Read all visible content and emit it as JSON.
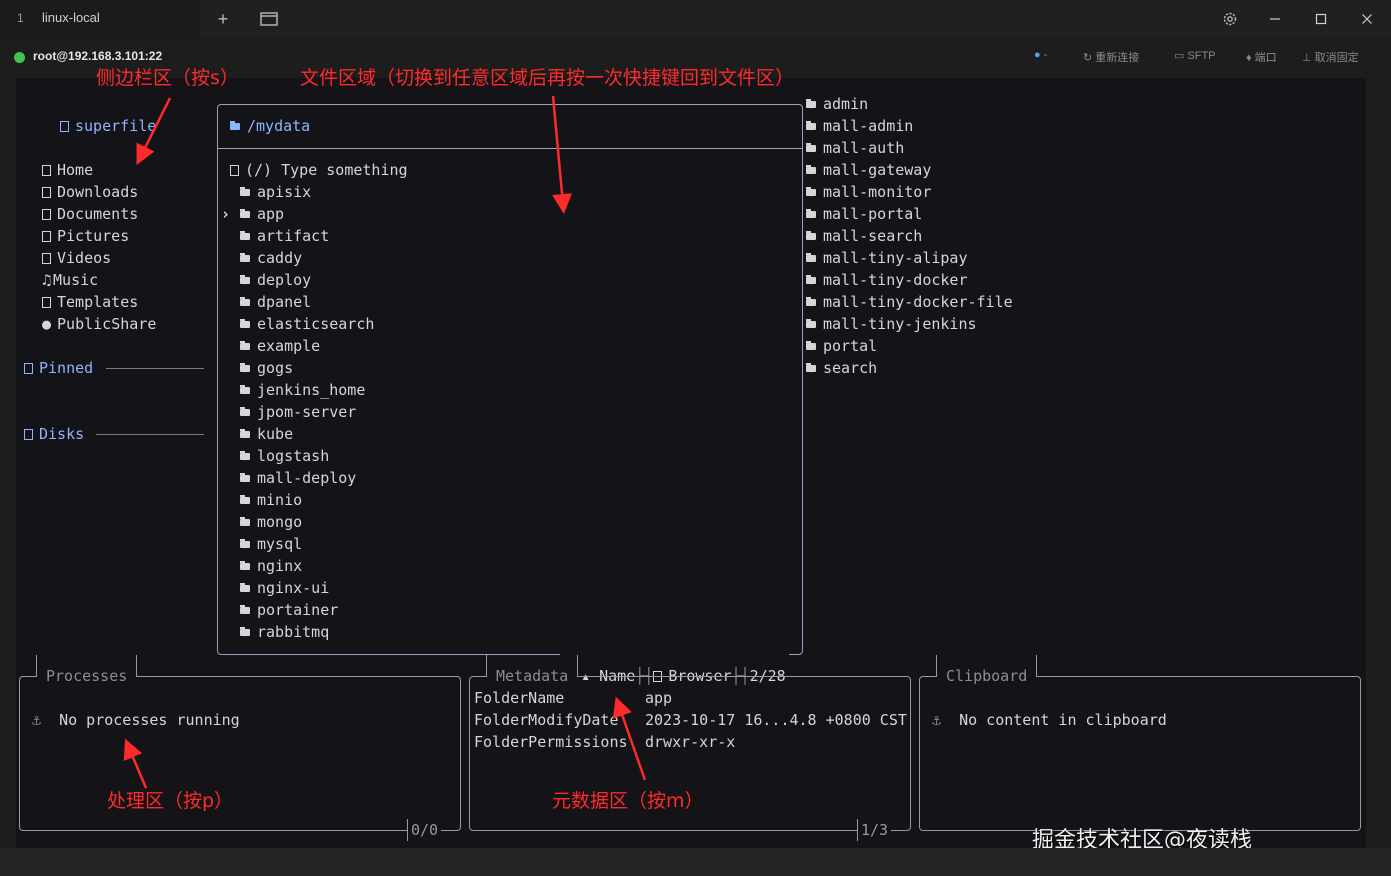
{
  "window": {
    "tab_number": "1",
    "tab_title": "linux-local",
    "new_tab_icon": "plus-icon",
    "tab_overview_icon": "windows-icon",
    "settings_icon": "gear-icon",
    "minimize_icon": "minimize-icon",
    "maximize_icon": "maximize-icon",
    "close_icon": "close-icon"
  },
  "status": {
    "host": "root@192.168.3.101:22",
    "connected_color": "#3fc44f",
    "hint": "-",
    "reconnect": "重新连接",
    "sftp": "SFTP",
    "port": "端口",
    "unpin": "取消固定"
  },
  "sidebar": {
    "title": "superfile",
    "items": [
      {
        "label": "Home",
        "icon": "folder-icon"
      },
      {
        "label": "Downloads",
        "icon": "folder-icon"
      },
      {
        "label": "Documents",
        "icon": "folder-icon"
      },
      {
        "label": "Pictures",
        "icon": "folder-icon"
      },
      {
        "label": "Videos",
        "icon": "folder-icon"
      },
      {
        "label": "Music",
        "icon": "music-icon"
      },
      {
        "label": "Templates",
        "icon": "folder-icon"
      },
      {
        "label": "PublicShare",
        "icon": "globe-icon"
      }
    ],
    "pinned": "Pinned",
    "disks": "Disks"
  },
  "file_panel": {
    "path": "/mydata",
    "search_placeholder": "(/) Type something",
    "selected_index": 1,
    "files": [
      "apisix",
      "app",
      "artifact",
      "caddy",
      "deploy",
      "dpanel",
      "elasticsearch",
      "example",
      "gogs",
      "jenkins_home",
      "jpom-server",
      "kube",
      "logstash",
      "mall-deploy",
      "minio",
      "mongo",
      "mysql",
      "nginx",
      "nginx-ui",
      "portainer",
      "rabbitmq"
    ],
    "sort": "Name",
    "mode": "Browser",
    "count": "2/28"
  },
  "preview": {
    "items": [
      "admin",
      "mall-admin",
      "mall-auth",
      "mall-gateway",
      "mall-monitor",
      "mall-portal",
      "mall-search",
      "mall-tiny-alipay",
      "mall-tiny-docker",
      "mall-tiny-docker-file",
      "mall-tiny-jenkins",
      "portal",
      "search"
    ]
  },
  "processes": {
    "title": "Processes",
    "message": "No processes running",
    "count": "0/0"
  },
  "metadata": {
    "title": "Metadata",
    "rows": [
      {
        "key": "FolderName",
        "value": "app"
      },
      {
        "key": "FolderModifyDate",
        "value": "2023-10-17 16...4.8 +0800 CST"
      },
      {
        "key": "FolderPermissions",
        "value": "drwxr-xr-x"
      }
    ],
    "count": "1/3"
  },
  "clipboard": {
    "title": "Clipboard",
    "message": "No content in clipboard"
  },
  "annotations": {
    "sidebar": "侧边栏区（按s）",
    "file": "文件区域（切换到任意区域后再按一次快捷键回到文件区）",
    "process": "处理区（按p）",
    "metadata": "元数据区（按m）",
    "color": "#ff2a2a"
  },
  "watermark": "掘金技术社区@夜读栈"
}
